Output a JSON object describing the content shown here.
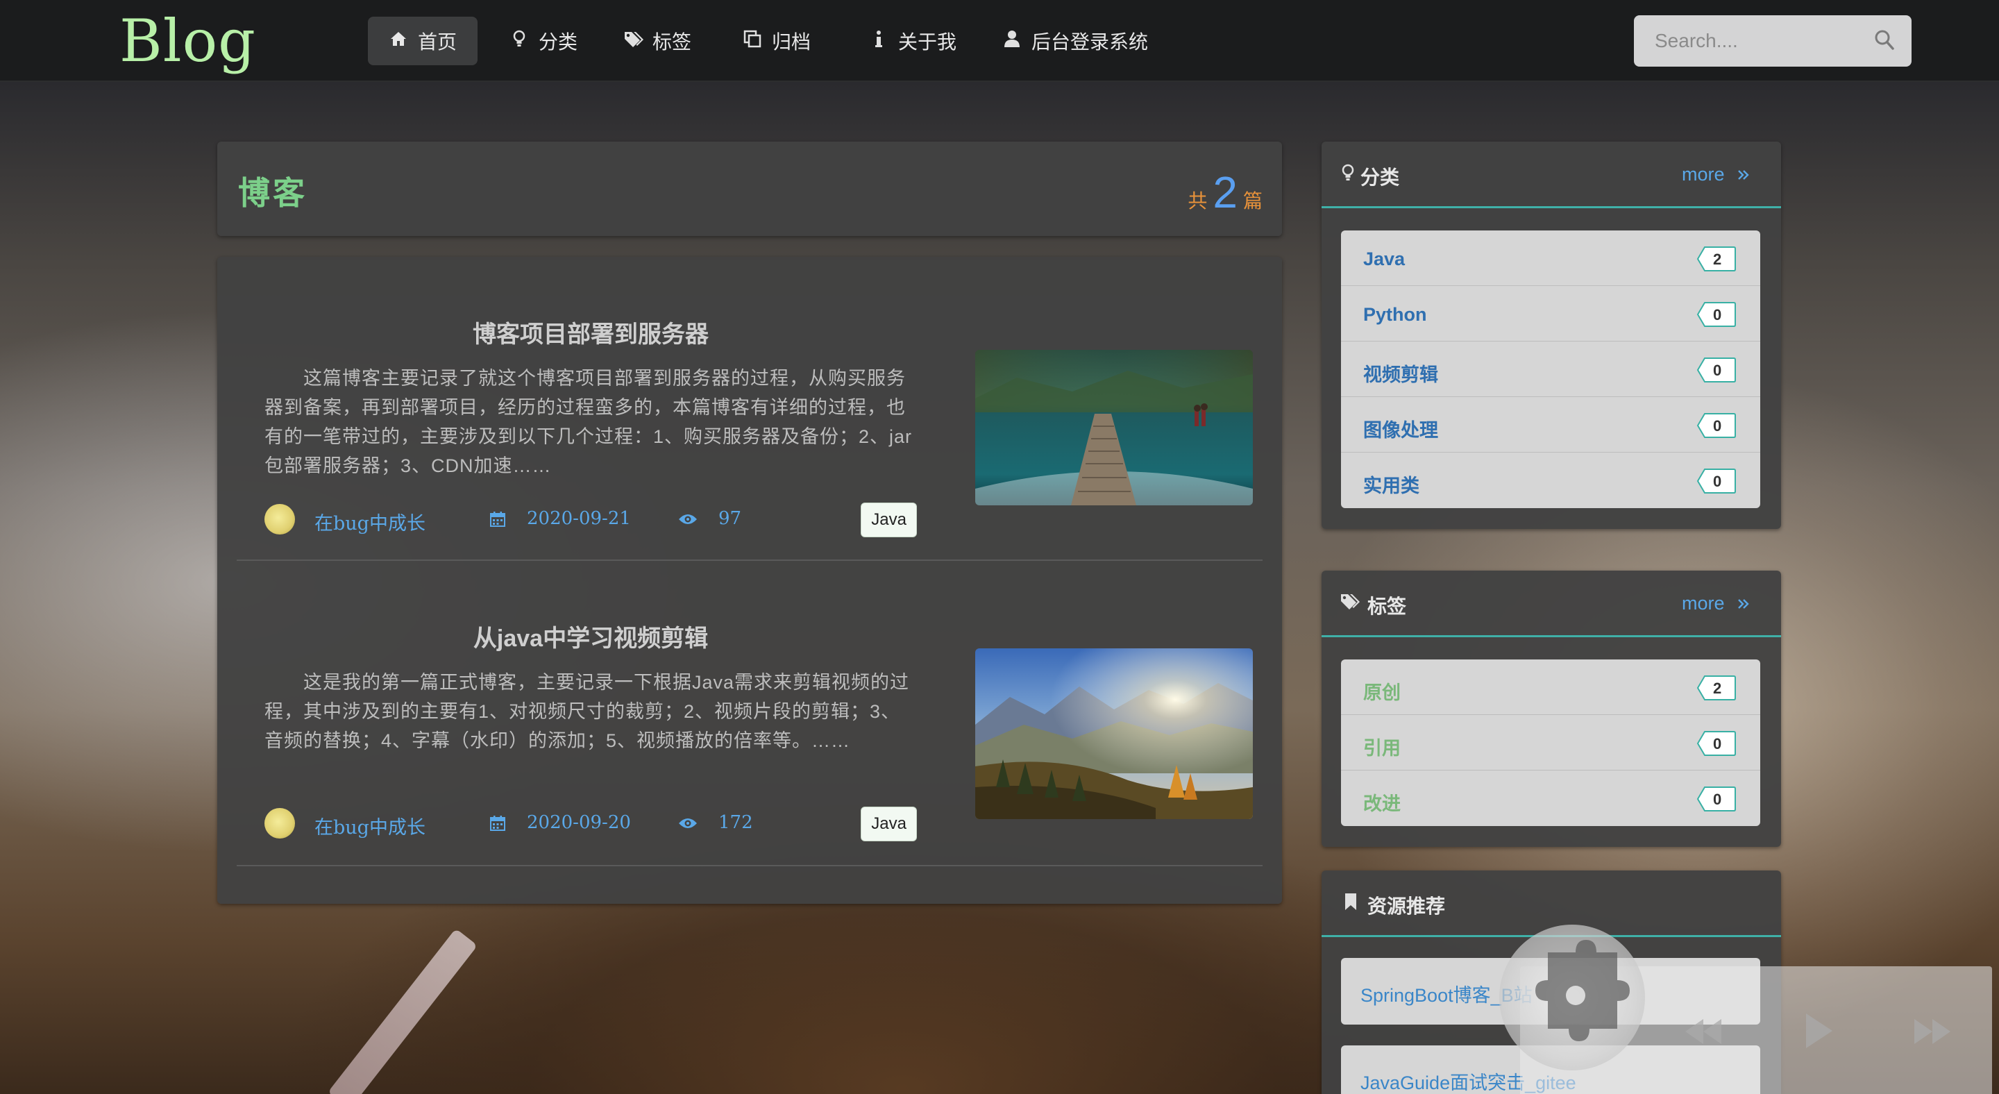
{
  "navbar": {
    "logo": "Blog",
    "items": [
      {
        "label": "首页",
        "icon": "home-icon",
        "active": true
      },
      {
        "label": "分类",
        "icon": "lightbulb-icon"
      },
      {
        "label": "标签",
        "icon": "tags-icon"
      },
      {
        "label": "归档",
        "icon": "clone-icon"
      },
      {
        "label": "关于我",
        "icon": "info-icon"
      },
      {
        "label": "后台登录系统",
        "icon": "user-icon"
      }
    ],
    "search": {
      "placeholder": "Search...."
    }
  },
  "main": {
    "title": "博客",
    "count_prefix": "共",
    "count": "2",
    "count_suffix": "篇",
    "posts": [
      {
        "title": "博客项目部署到服务器",
        "excerpt": "这篇博客主要记录了就这个博客项目部署到服务器的过程，从购买服务器到备案，再到部署项目，经历的过程蛮多的，本篇博客有详细的过程，也有的一笔带过的，主要涉及到以下几个过程：1、购买服务器及备份；2、jar包部署服务器；3、CDN加速……",
        "author": "在bug中成长",
        "date": "2020-09-21",
        "views": "97",
        "tag": "Java"
      },
      {
        "title": "从java中学习视频剪辑",
        "excerpt": "这是我的第一篇正式博客，主要记录一下根据Java需求来剪辑视频的过程，其中涉及到的主要有1、对视频尺寸的裁剪；2、视频片段的剪辑；3、音频的替换；4、字幕（水印）的添加；5、视频播放的倍率等。……",
        "author": "在bug中成长",
        "date": "2020-09-20",
        "views": "172",
        "tag": "Java"
      }
    ]
  },
  "sidebar": {
    "categories": {
      "title": "分类",
      "more": "more",
      "items": [
        {
          "label": "Java",
          "count": "2"
        },
        {
          "label": "Python",
          "count": "0"
        },
        {
          "label": "视频剪辑",
          "count": "0"
        },
        {
          "label": "图像处理",
          "count": "0"
        },
        {
          "label": "实用类",
          "count": "0"
        }
      ]
    },
    "tags": {
      "title": "标签",
      "more": "more",
      "items": [
        {
          "label": "原创",
          "count": "2"
        },
        {
          "label": "引用",
          "count": "0"
        },
        {
          "label": "改进",
          "count": "0"
        }
      ]
    },
    "resources": {
      "title": "资源推荐",
      "items": [
        {
          "label": "SpringBoot博客_B站"
        },
        {
          "label": "JavaGuide面试突击_gitee"
        }
      ]
    }
  },
  "colors": {
    "accent_teal": "#3fb0a8",
    "link_blue": "#5aa8e8",
    "logo_green": "#b8f0a8",
    "title_green": "#7cd08a",
    "count_orange": "#e8923a"
  }
}
